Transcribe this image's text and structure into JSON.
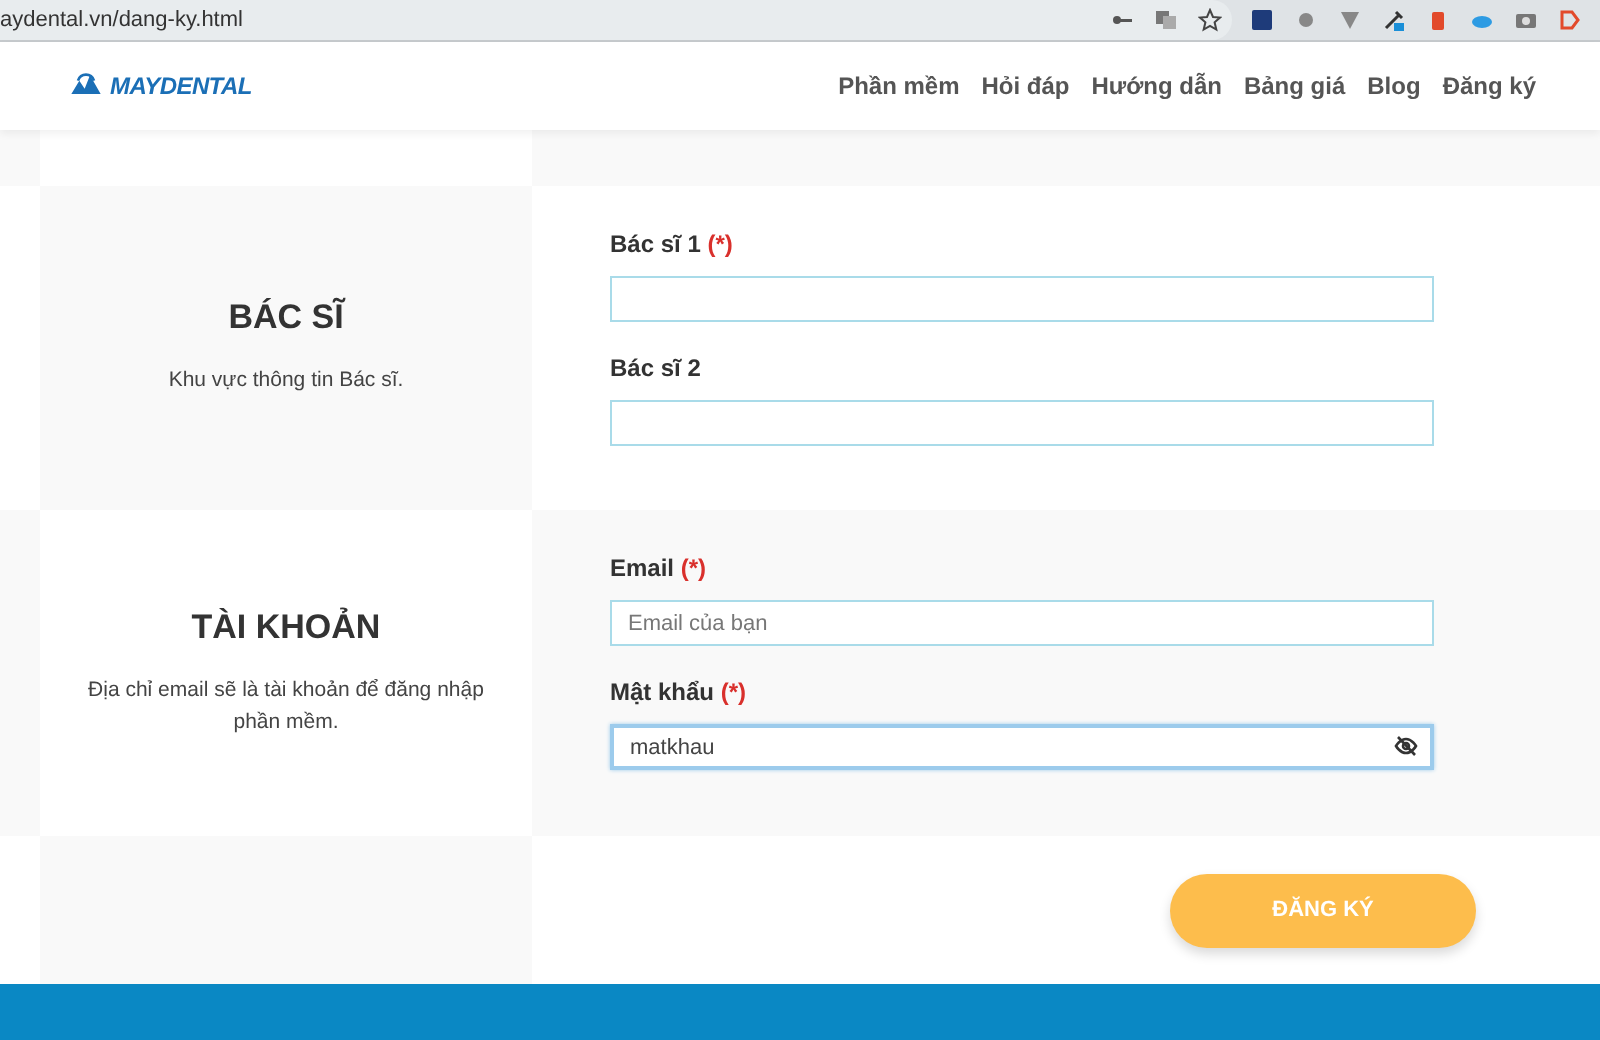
{
  "browser": {
    "url": "aydental.vn/dang-ky.html"
  },
  "header": {
    "logo": "MAYDENTAL",
    "nav": [
      {
        "label": "Phần mềm"
      },
      {
        "label": "Hỏi đáp"
      },
      {
        "label": "Hướng dẫn"
      },
      {
        "label": "Bảng giá"
      },
      {
        "label": "Blog"
      },
      {
        "label": "Đăng ký"
      }
    ]
  },
  "sections": [
    {
      "title": "BÁC SĨ",
      "description": "Khu vực thông tin Bác sĩ.",
      "fields": [
        {
          "kind": "text",
          "label": "Bác sĩ 1",
          "required_mark": "(*)",
          "focused": false
        },
        {
          "kind": "text",
          "label": "Bác sĩ 2",
          "focused": false
        }
      ]
    },
    {
      "title": "TÀI KHOẢN",
      "description": "Địa chỉ email sẽ là tài khoản để đăng nhập phần mềm.",
      "fields": [
        {
          "kind": "text",
          "label": "Email",
          "required_mark": "(*)",
          "placeholder": "Email của bạn",
          "focused": false
        },
        {
          "kind": "password",
          "label": "Mật khẩu",
          "required_mark": "(*)",
          "value": "matkhau",
          "focused": true
        }
      ]
    }
  ],
  "submit": {
    "label": "ĐĂNG KÝ"
  }
}
